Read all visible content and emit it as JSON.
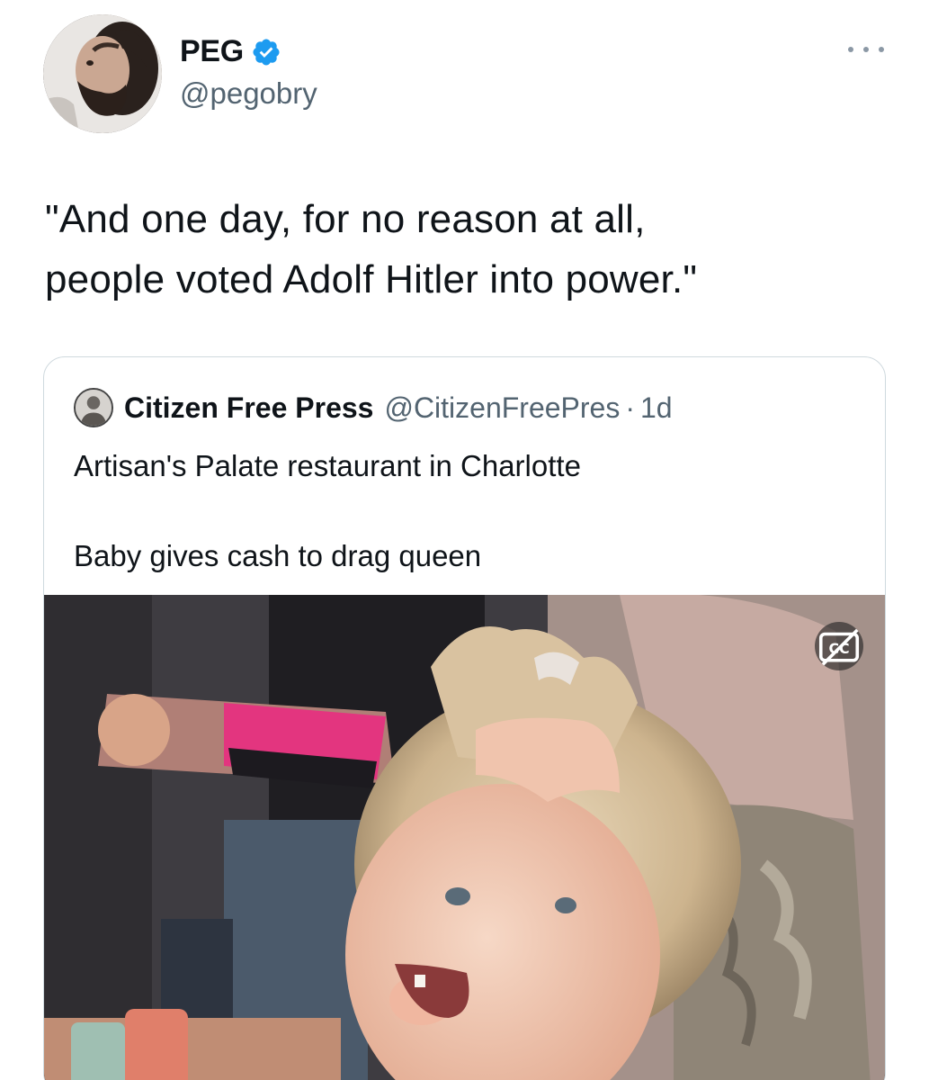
{
  "author": {
    "display_name": "PEG",
    "handle": "@pegobry",
    "verified": true,
    "verified_color": "#1d9bf0"
  },
  "tweet": {
    "text": "\"And one day, for no reason at all,\npeople voted Adolf Hitler into power.\""
  },
  "quoted_tweet": {
    "display_name": "Citizen Free Press",
    "handle": "@CitizenFreePres",
    "separator": "·",
    "time": "1d",
    "text": "Artisan's Palate restaurant in Charlotte\n\nBaby gives cash to drag queen"
  },
  "icons": {
    "more": "more-horizontal-icon",
    "verified": "verified-badge-icon",
    "captions": "closed-captions-off-icon"
  }
}
